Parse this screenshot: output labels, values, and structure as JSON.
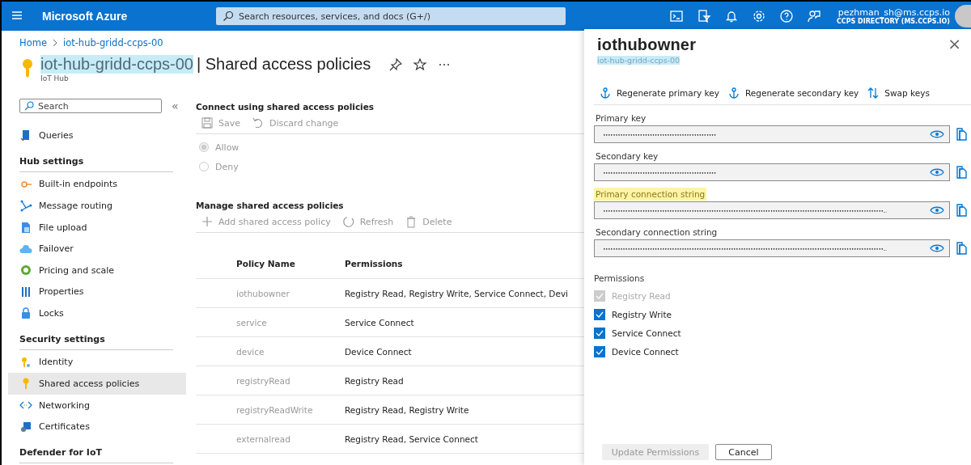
{
  "topbar": {
    "brand": "Microsoft Azure",
    "search": {
      "placeholder": "Search resources, services, and docs (G+/)"
    },
    "user": {
      "email": "pezhman_sh@ms.ccps.io",
      "directory": "CCPS DIRECTORY (MS.CCPS.IO)"
    }
  },
  "breadcrumb": [
    "Home",
    "iot-hub-gridd-ccps-00"
  ],
  "header": {
    "resource": "iot-hub-gridd-ccps-00",
    "resource_selected": true,
    "page": "| Shared access policies",
    "subtitle": "IoT Hub"
  },
  "sidebar": {
    "search": {
      "placeholder": "Search"
    },
    "collapse": "«",
    "groups": [
      {
        "items": [
          {
            "label": "Queries",
            "selected": false
          }
        ]
      },
      {
        "title": "Hub settings",
        "items": [
          {
            "label": "Built-in endpoints",
            "selected": false
          },
          {
            "label": "Message routing",
            "selected": false
          },
          {
            "label": "File upload",
            "selected": false
          },
          {
            "label": "Failover",
            "selected": false
          },
          {
            "label": "Pricing and scale",
            "selected": false
          },
          {
            "label": "Properties",
            "selected": false
          },
          {
            "label": "Locks",
            "selected": false
          }
        ]
      },
      {
        "title": "Security settings",
        "items": [
          {
            "label": "Identity",
            "selected": false
          },
          {
            "label": "Shared access policies",
            "selected": true
          },
          {
            "label": "Networking",
            "selected": false
          },
          {
            "label": "Certificates",
            "selected": false
          }
        ]
      },
      {
        "title": "Defender for IoT"
      }
    ]
  },
  "connect": {
    "title": "Connect using shared access policies",
    "toolbar": [
      {
        "label": "Save",
        "disabled": true
      },
      {
        "label": "Discard change",
        "disabled": true
      }
    ],
    "options": [
      {
        "label": "Allow",
        "selected": true,
        "disabled": true
      },
      {
        "label": "Deny",
        "selected": false,
        "disabled": true
      }
    ]
  },
  "manage": {
    "title": "Manage shared access policies",
    "toolbar": [
      {
        "label": "Add shared access policy",
        "disabled": true
      },
      {
        "label": "Refresh",
        "disabled": true
      },
      {
        "label": "Delete",
        "disabled": true
      }
    ],
    "table": {
      "columns": [
        "Policy Name",
        "Permissions"
      ],
      "rows": [
        [
          "iothubowner",
          "Registry Read, Registry Write, Service Connect, Devi"
        ],
        [
          "service",
          "Service Connect"
        ],
        [
          "device",
          "Device Connect"
        ],
        [
          "registryRead",
          "Registry Read"
        ],
        [
          "registryReadWrite",
          "Registry Read, Registry Write"
        ],
        [
          "externalread",
          "Registry Read, Service Connect"
        ]
      ]
    }
  },
  "panel": {
    "title": "iothubowner",
    "subtitle": "iot-hub-gridd-ccps-00",
    "subtitle_selected": true,
    "close": "×",
    "toolbar": [
      "Regenerate primary key",
      "Regenerate secondary key",
      "Swap keys"
    ],
    "fields": [
      {
        "label": "Primary key",
        "highlighted": false,
        "value": "••••••••••••••••••••••••••••••••••••••••••••••"
      },
      {
        "label": "Secondary key",
        "highlighted": false,
        "value": "••••••••••••••••••••••••••••••••••••••••••••••"
      },
      {
        "label": "Primary connection string",
        "highlighted": true,
        "value": "••••••••••••••••••••••••••••••••••••••••••••••••••••••••••••••••••••••••••••••••••••••••••••••••••••••••••••••••••..."
      },
      {
        "label": "Secondary connection string",
        "highlighted": false,
        "value": "••••••••••••••••••••••••••••••••••••••••••••••••••••••••••••••••••••••••••••••••••••••••••••••••••••••••••••••••••..."
      }
    ],
    "permissions_title": "Permissions",
    "permissions": [
      {
        "label": "Registry Read",
        "checked": true,
        "disabled": true
      },
      {
        "label": "Registry Write",
        "checked": true,
        "disabled": false
      },
      {
        "label": "Service Connect",
        "checked": true,
        "disabled": false
      },
      {
        "label": "Device Connect",
        "checked": true,
        "disabled": false
      }
    ],
    "buttons": [
      {
        "label": "Update Permissions",
        "disabled": true
      },
      {
        "label": "Cancel",
        "disabled": false
      }
    ]
  }
}
